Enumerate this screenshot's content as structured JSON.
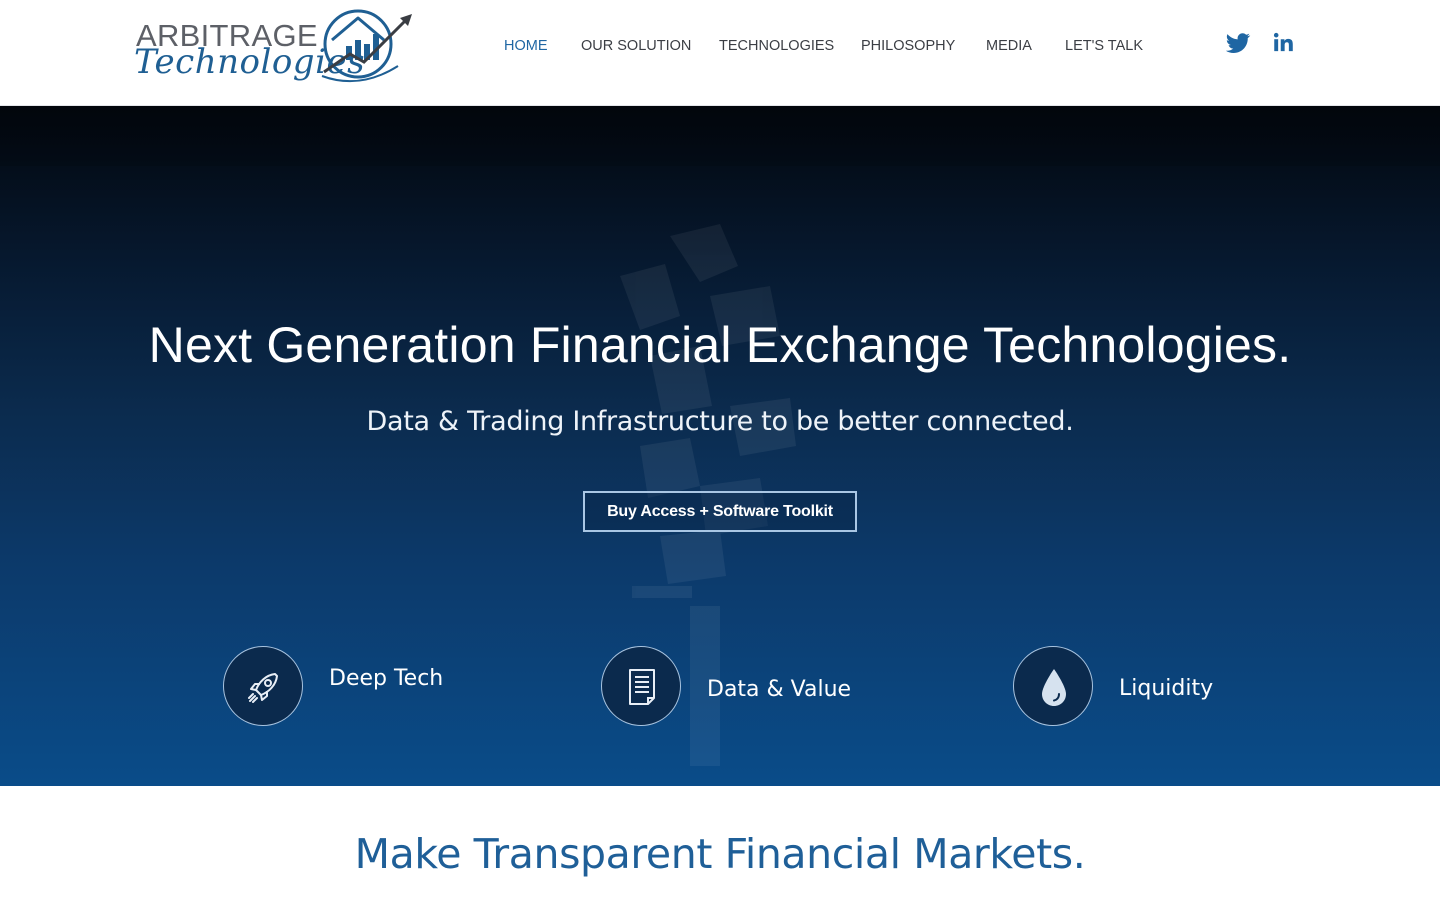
{
  "brand": {
    "name_top": "ARBITRAGE",
    "name_script": "Technologies",
    "logo_icon": "house-chart-arrow-icon"
  },
  "nav": {
    "items": [
      {
        "label": "HOME",
        "active": true
      },
      {
        "label": "OUR SOLUTION",
        "active": false
      },
      {
        "label": "TECHNOLOGIES",
        "active": false
      },
      {
        "label": "PHILOSOPHY",
        "active": false
      },
      {
        "label": "MEDIA",
        "active": false
      },
      {
        "label": "LET'S TALK",
        "active": false
      }
    ]
  },
  "social": {
    "items": [
      {
        "name": "twitter",
        "icon": "twitter-icon"
      },
      {
        "name": "linkedin",
        "icon": "linkedin-icon"
      }
    ]
  },
  "hero": {
    "title": "Next Generation Financial Exchange Technologies.",
    "subtitle": "Data & Trading Infrastructure to be better connected.",
    "cta_label": "Buy Access + Software Toolkit",
    "features": [
      {
        "label": "Deep Tech",
        "icon": "rocket-icon"
      },
      {
        "label": "Data & Value",
        "icon": "document-icon"
      },
      {
        "label": "Liquidity",
        "icon": "water-drop-icon"
      }
    ]
  },
  "section": {
    "title": "Make Transparent Financial Markets."
  },
  "colors": {
    "accent": "#1f66a3",
    "nav_text": "#3b3e44",
    "hero_top": "#03070d",
    "hero_bottom": "#0a4c89",
    "section_title": "#1f5f98",
    "cta_border": "#a9c6e4"
  }
}
